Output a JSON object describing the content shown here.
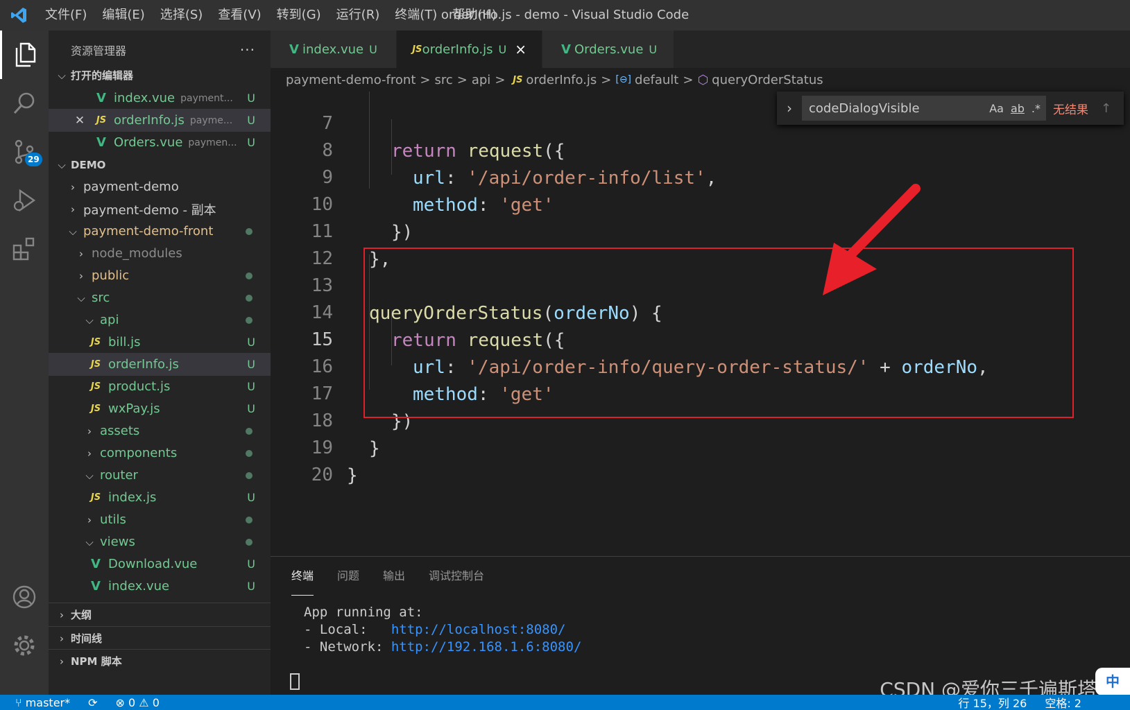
{
  "titlebar": {
    "menu": [
      "文件(F)",
      "编辑(E)",
      "选择(S)",
      "查看(V)",
      "转到(G)",
      "运行(R)",
      "终端(T)",
      "帮助(H)"
    ],
    "window_title": "orderInfo.js - demo - Visual Studio Code"
  },
  "activity_bar": {
    "scm_badge": "29"
  },
  "sidebar": {
    "title": "资源管理器",
    "more": "···",
    "open_editors_title": "打开的编辑器",
    "open_editors": [
      {
        "name": "index.vue",
        "desc": "payment...",
        "status": "U"
      },
      {
        "name": "orderInfo.js",
        "desc": "payme...",
        "status": "U"
      },
      {
        "name": "Orders.vue",
        "desc": "paymen...",
        "status": "U"
      }
    ],
    "workspace_title": "DEMO",
    "tree": [
      {
        "name": "payment-demo"
      },
      {
        "name": "payment-demo - 副本"
      },
      {
        "name": "payment-demo-front"
      },
      {
        "name": "node_modules"
      },
      {
        "name": "public"
      },
      {
        "name": "src"
      },
      {
        "name": "api"
      },
      {
        "name": "bill.js",
        "status": "U"
      },
      {
        "name": "orderInfo.js",
        "status": "U"
      },
      {
        "name": "product.js",
        "status": "U"
      },
      {
        "name": "wxPay.js",
        "status": "U"
      },
      {
        "name": "assets"
      },
      {
        "name": "components"
      },
      {
        "name": "router"
      },
      {
        "name": "index.js",
        "status": "U"
      },
      {
        "name": "utils"
      },
      {
        "name": "views"
      },
      {
        "name": "Download.vue",
        "status": "U"
      },
      {
        "name": "index.vue",
        "status": "U"
      }
    ],
    "outline_title": "大纲",
    "timeline_title": "时间线",
    "npm_title": "NPM 脚本"
  },
  "tabs": [
    {
      "name": "index.vue",
      "status": "U"
    },
    {
      "name": "orderInfo.js",
      "status": "U",
      "close": "×"
    },
    {
      "name": "Orders.vue",
      "status": "U"
    }
  ],
  "breadcrumb": {
    "items": [
      "payment-demo-front",
      "src",
      "api",
      "orderInfo.js",
      "default",
      "queryOrderStatus"
    ],
    "sep": ">"
  },
  "find_widget": {
    "value": "codeDialogVisible",
    "opt_case": "Aa",
    "opt_word": "ab",
    "opt_regex": ".*",
    "result": "无结果"
  },
  "editor": {
    "current_line": "15",
    "lines": [
      {
        "n": "7"
      },
      {
        "n": "8"
      },
      {
        "n": "9"
      },
      {
        "n": "10"
      },
      {
        "n": "11"
      },
      {
        "n": "12"
      },
      {
        "n": "13"
      },
      {
        "n": "14"
      },
      {
        "n": "15"
      },
      {
        "n": "16"
      },
      {
        "n": "17"
      },
      {
        "n": "18"
      },
      {
        "n": "19"
      },
      {
        "n": "20"
      }
    ],
    "code": {
      "return": "return",
      "request": "request",
      "open_call": "({",
      "url_key": "url",
      "colon": ": ",
      "list_url": "'/api/order-info/list'",
      "comma": ",",
      "method_key": "method",
      "get": "'get'",
      "close_call": "})",
      "close_obj_comma": "},",
      "fn_name": "queryOrderStatus",
      "param_open": "(",
      "param": "orderNo",
      "param_close": ") {",
      "status_url": "'/api/order-info/query-order-status/'",
      "plus": " + ",
      "order_no": "orderNo",
      "close_brace": "}"
    }
  },
  "panel": {
    "tabs": [
      "终端",
      "问题",
      "输出",
      "调试控制台"
    ],
    "terminal": {
      "line1": "App running at:",
      "local_label": "- Local:   ",
      "local_url": "http://localhost:8080/",
      "network_label": "- Network: ",
      "network_url": "http://192.168.1.6:8080/"
    },
    "watermark": "CSDN @爱你三千遍斯塔克",
    "ime": "中"
  },
  "statusbar": {
    "branch": "master*",
    "errors": "⊗ 0 ⚠ 0",
    "position": "行 15，列 26",
    "spaces": "空格: 2"
  },
  "colors": {
    "accent": "#007acc",
    "highlight_box": "#e0202a",
    "arrow": "#e8202a"
  }
}
